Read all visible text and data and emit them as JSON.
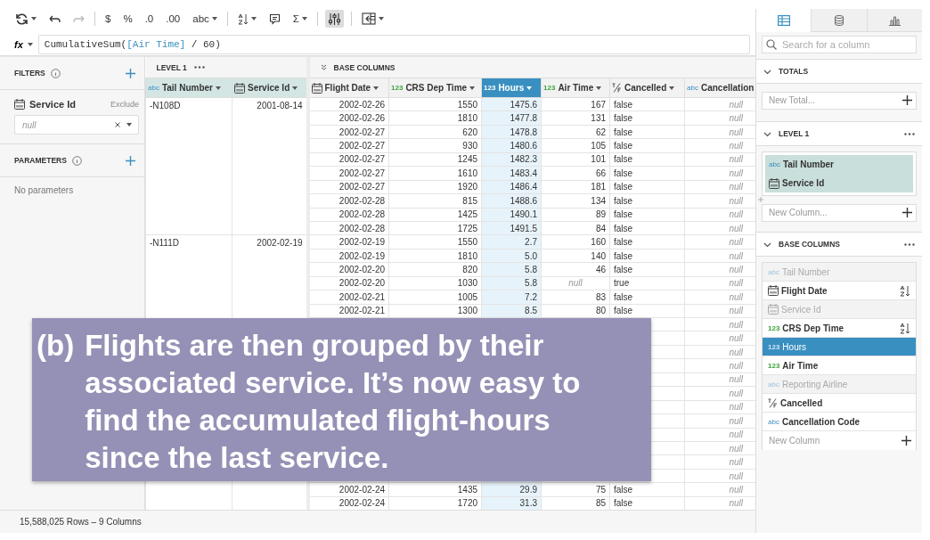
{
  "toolbar": [
    {
      "kind": "refresh",
      "caret": true,
      "disabled": false,
      "selected": false
    },
    {
      "kind": "undo",
      "caret": false,
      "disabled": false,
      "selected": false
    },
    {
      "kind": "redo",
      "caret": false,
      "disabled": true,
      "selected": false
    },
    {
      "kind": "divider"
    },
    {
      "kind": "text",
      "label": "$",
      "caret": false,
      "disabled": false,
      "selected": false
    },
    {
      "kind": "text",
      "label": "%",
      "caret": false,
      "disabled": false,
      "selected": false
    },
    {
      "kind": "text",
      "label": ".0",
      "caret": false,
      "disabled": false,
      "selected": false
    },
    {
      "kind": "text",
      "label": ".00",
      "caret": false,
      "disabled": false,
      "selected": false
    },
    {
      "kind": "text",
      "label": "abc",
      "caret": true,
      "disabled": false,
      "selected": false
    },
    {
      "kind": "divider"
    },
    {
      "kind": "sort",
      "caret": true,
      "disabled": false,
      "selected": false
    },
    {
      "kind": "comment",
      "caret": false,
      "disabled": false,
      "selected": false
    },
    {
      "kind": "text",
      "label": "Σ",
      "caret": true,
      "disabled": false,
      "selected": false
    },
    {
      "kind": "divider"
    },
    {
      "kind": "column-settings",
      "caret": false,
      "disabled": false,
      "selected": true
    },
    {
      "kind": "divider"
    },
    {
      "kind": "panel",
      "caret": true,
      "disabled": false,
      "selected": false
    }
  ],
  "formula": {
    "label": "fx",
    "parts": [
      {
        "kind": "plain",
        "text": "CumulativeSum("
      },
      {
        "kind": "ref",
        "text": "[Air Time]"
      },
      {
        "kind": "plain",
        "text": " / 60)"
      }
    ]
  },
  "left_panel": {
    "filters": {
      "title": "FILTERS",
      "items": [
        {
          "label": "Service Id",
          "kind": "date",
          "action": "Exclude",
          "placeholder": "null"
        }
      ]
    },
    "parameters": {
      "title": "PARAMETERS",
      "empty_text": "No parameters"
    }
  },
  "table": {
    "level_title": "LEVEL 1",
    "base_title": "BASE COLUMNS",
    "level_columns": [
      {
        "label": "Tail Number",
        "kind": "text",
        "badge": "abc",
        "selected": false
      },
      {
        "label": "Service Id",
        "kind": "date",
        "selected": false
      }
    ],
    "base_columns": [
      {
        "label": "Flight Date",
        "kind": "date",
        "selected": false
      },
      {
        "label": "CRS Dep Time",
        "kind": "number",
        "badge": "123",
        "selected": false
      },
      {
        "label": "Hours",
        "kind": "number",
        "badge": "123",
        "selected": true
      },
      {
        "label": "Air Time",
        "kind": "number",
        "badge": "123",
        "selected": false
      },
      {
        "label": "Cancelled",
        "kind": "boolean",
        "selected": false
      },
      {
        "label": "Cancellation",
        "kind": "text",
        "badge": "abc",
        "selected": false
      }
    ],
    "groups": [
      {
        "tail_number": "-N108D",
        "service_id": "2001-08-14",
        "rows": [
          {
            "cells": [
              "2002-02-26",
              "1550",
              "1475.6",
              "167",
              "false",
              {
                "text": "null",
                "missing": true
              }
            ]
          },
          {
            "cells": [
              "2002-02-26",
              "1810",
              "1477.8",
              "131",
              "false",
              {
                "text": "null",
                "missing": true
              }
            ]
          },
          {
            "cells": [
              "2002-02-27",
              "620",
              "1478.8",
              "62",
              "false",
              {
                "text": "null",
                "missing": true
              }
            ]
          },
          {
            "cells": [
              "2002-02-27",
              "930",
              "1480.6",
              "105",
              "false",
              {
                "text": "null",
                "missing": true
              }
            ]
          },
          {
            "cells": [
              "2002-02-27",
              "1245",
              "1482.3",
              "101",
              "false",
              {
                "text": "null",
                "missing": true
              }
            ]
          },
          {
            "cells": [
              "2002-02-27",
              "1610",
              "1483.4",
              "66",
              "false",
              {
                "text": "null",
                "missing": true
              }
            ]
          },
          {
            "cells": [
              "2002-02-27",
              "1920",
              "1486.4",
              "181",
              "false",
              {
                "text": "null",
                "missing": true
              }
            ]
          },
          {
            "cells": [
              "2002-02-28",
              "815",
              "1488.6",
              "134",
              "false",
              {
                "text": "null",
                "missing": true
              }
            ]
          },
          {
            "cells": [
              "2002-02-28",
              "1425",
              "1490.1",
              "89",
              "false",
              {
                "text": "null",
                "missing": true
              }
            ]
          },
          {
            "cells": [
              "2002-02-28",
              "1725",
              "1491.5",
              "84",
              "false",
              {
                "text": "null",
                "missing": true
              }
            ]
          }
        ]
      },
      {
        "tail_number": "-N111D",
        "service_id": "2002-02-19",
        "rows": [
          {
            "cells": [
              "2002-02-19",
              "1550",
              "2.7",
              "160",
              "false",
              {
                "text": "null",
                "missing": true
              }
            ]
          },
          {
            "cells": [
              "2002-02-19",
              "1810",
              "5.0",
              "140",
              "false",
              {
                "text": "null",
                "missing": true
              }
            ]
          },
          {
            "cells": [
              "2002-02-20",
              "820",
              "5.8",
              "46",
              "false",
              {
                "text": "null",
                "missing": true
              }
            ]
          },
          {
            "cells": [
              "2002-02-20",
              "1030",
              "5.8",
              {
                "text": "null",
                "missing": true
              },
              "true",
              {
                "text": "null",
                "missing": true
              }
            ]
          },
          {
            "cells": [
              "2002-02-21",
              "1005",
              "7.2",
              "83",
              "false",
              {
                "text": "null",
                "missing": true
              }
            ]
          },
          {
            "cells": [
              "2002-02-21",
              "1300",
              "8.5",
              "80",
              "false",
              {
                "text": "null",
                "missing": true
              }
            ]
          },
          {
            "cells": [
              "",
              "",
              "",
              "",
              "",
              {
                "text": "null",
                "missing": true
              }
            ]
          },
          {
            "cells": [
              "",
              "",
              "",
              "",
              "",
              {
                "text": "null",
                "missing": true
              }
            ]
          },
          {
            "cells": [
              "",
              "",
              "",
              "",
              "",
              {
                "text": "null",
                "missing": true
              }
            ]
          },
          {
            "cells": [
              "",
              "",
              "",
              "",
              "",
              {
                "text": "null",
                "missing": true
              }
            ]
          },
          {
            "cells": [
              "",
              "",
              "",
              "",
              "",
              {
                "text": "null",
                "missing": true
              }
            ]
          },
          {
            "cells": [
              "",
              "",
              "",
              "",
              "",
              {
                "text": "null",
                "missing": true
              }
            ]
          },
          {
            "cells": [
              "",
              "",
              "",
              "",
              "",
              {
                "text": "null",
                "missing": true
              }
            ]
          },
          {
            "cells": [
              "",
              "",
              "",
              "",
              "",
              {
                "text": "null",
                "missing": true
              }
            ]
          },
          {
            "cells": [
              "",
              "",
              "",
              "",
              "",
              {
                "text": "null",
                "missing": true
              }
            ]
          },
          {
            "cells": [
              "",
              "",
              "",
              "",
              "",
              {
                "text": "null",
                "missing": true
              }
            ]
          },
          {
            "cells": [
              "",
              "",
              "",
              "",
              "",
              {
                "text": "null",
                "missing": true
              }
            ]
          },
          {
            "cells": [
              "",
              "",
              "",
              "",
              "",
              {
                "text": "null",
                "missing": true
              }
            ]
          },
          {
            "cells": [
              "2002-02-24",
              "1435",
              "29.9",
              "75",
              "false",
              {
                "text": "null",
                "missing": true
              }
            ]
          },
          {
            "cells": [
              "2002-02-24",
              "1720",
              "31.3",
              "85",
              "false",
              {
                "text": "null",
                "missing": true
              }
            ]
          }
        ]
      }
    ]
  },
  "status_bar": "15,588,025 Rows – 9 Columns",
  "right_panel": {
    "tabs": [
      {
        "kind": "table",
        "selected": true
      },
      {
        "kind": "database",
        "selected": false
      },
      {
        "kind": "chart",
        "selected": false
      }
    ],
    "search": {
      "placeholder": "Search for a column"
    },
    "totals": {
      "title": "TOTALS",
      "expanded": true,
      "new_placeholder": "New Total..."
    },
    "level": {
      "title": "LEVEL 1",
      "expanded": true,
      "columns": [
        {
          "label": "Tail Number",
          "kind": "text",
          "badge": "abc"
        },
        {
          "label": "Service Id",
          "kind": "date"
        }
      ],
      "new_placeholder": "New Column..."
    },
    "base": {
      "title": "BASE COLUMNS",
      "expanded": true,
      "columns": [
        {
          "label": "Tail Number",
          "kind": "text",
          "badge": "abc",
          "dimmed": true,
          "sorted": false,
          "selected": false
        },
        {
          "label": "Flight Date",
          "kind": "date",
          "dimmed": false,
          "sorted": true,
          "selected": false
        },
        {
          "label": "Service Id",
          "kind": "date",
          "dimmed": true,
          "sorted": false,
          "selected": false
        },
        {
          "label": "CRS Dep Time",
          "kind": "number",
          "badge": "123",
          "dimmed": false,
          "sorted": true,
          "selected": false
        },
        {
          "label": "Hours",
          "kind": "number",
          "badge": "123",
          "dimmed": false,
          "sorted": false,
          "selected": true
        },
        {
          "label": "Air Time",
          "kind": "number",
          "badge": "123",
          "dimmed": false,
          "sorted": false,
          "selected": false
        },
        {
          "label": "Reporting Airline",
          "kind": "text",
          "badge": "abc",
          "dimmed": true,
          "sorted": false,
          "selected": false
        },
        {
          "label": "Cancelled",
          "kind": "boolean",
          "dimmed": false,
          "sorted": false,
          "selected": false
        },
        {
          "label": "Cancellation Code",
          "kind": "text",
          "badge": "abc",
          "dimmed": false,
          "sorted": false,
          "selected": false
        }
      ],
      "new_placeholder": "New Column"
    }
  },
  "caption": {
    "letter": "(b)",
    "text": "Flights are then grouped by their associated service. It’s now easy to find the accumulated flight-hours since the last service."
  }
}
